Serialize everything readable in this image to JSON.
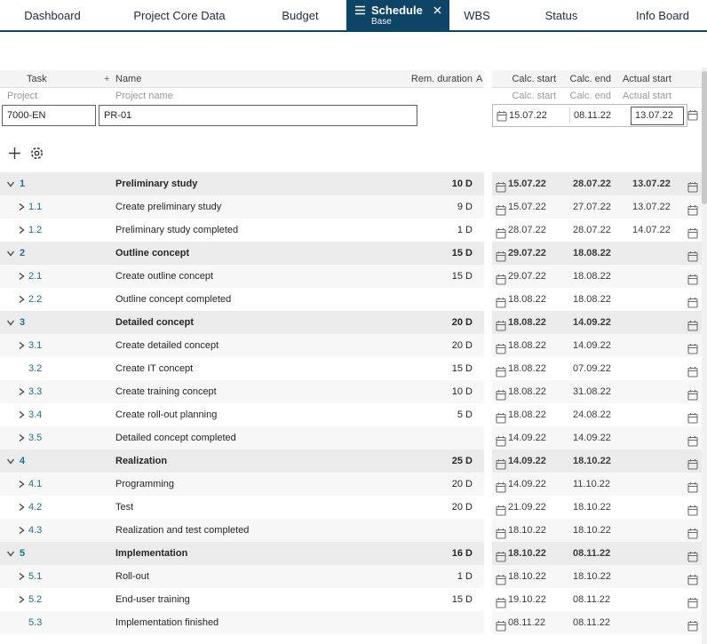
{
  "tabs": [
    {
      "label": "Dashboard"
    },
    {
      "label": "Project Core Data"
    },
    {
      "label": "Budget"
    },
    {
      "label": "Schedule",
      "sublabel": "Base",
      "active": true
    },
    {
      "label": "WBS"
    },
    {
      "label": "Status"
    },
    {
      "label": "Info Board"
    }
  ],
  "icons": {
    "active_tab_menu": "hamburger-icon",
    "active_tab_close": "close-icon",
    "toolbar_add": "plus-icon",
    "toolbar_settings": "gear-icon",
    "date_picker": "calendar-icon",
    "row_expand_open": "chevron-down-icon",
    "row_expand_closed": "chevron-right-icon"
  },
  "colors": {
    "active_tab_bg": "#0e4566",
    "active_tab_text": "#ffffff",
    "group_row_bg": "#ebebeb",
    "alt_row_bg": "#f7f7f7",
    "task_number_link": "#1e6f96",
    "header_bg": "#f4f4f4"
  },
  "table": {
    "headers": {
      "task": "Task",
      "add_column": "+",
      "name": "Name",
      "rem_duration": "Rem. duration",
      "a": "A",
      "calc_start": "Calc. start",
      "calc_end": "Calc. end",
      "actual_start": "Actual start"
    },
    "subheaders": {
      "project": "Project",
      "project_name": "Project name",
      "calc_start": "Calc. start",
      "calc_end": "Calc. end",
      "actual_start": "Actual start"
    },
    "project": {
      "id": "7000-EN",
      "name": "PR-01",
      "calc_start": "15.07.22",
      "calc_end": "08.11.22",
      "actual_start": "13.07.22"
    }
  },
  "rows": [
    {
      "num": "1",
      "name": "Preliminary study",
      "duration": "10 D",
      "calc_start": "15.07.22",
      "calc_end": "28.07.22",
      "actual_start": "13.07.22",
      "group": true,
      "chevron": "down"
    },
    {
      "num": "1.1",
      "name": "Create preliminary study",
      "duration": "9 D",
      "calc_start": "15.07.22",
      "calc_end": "27.07.22",
      "actual_start": "13.07.22",
      "group": false,
      "chevron": "right"
    },
    {
      "num": "1.2",
      "name": "Preliminary study completed",
      "duration": "1 D",
      "calc_start": "28.07.22",
      "calc_end": "28.07.22",
      "actual_start": "14.07.22",
      "group": false,
      "chevron": "right"
    },
    {
      "num": "2",
      "name": "Outline concept",
      "duration": "15 D",
      "calc_start": "29.07.22",
      "calc_end": "18.08.22",
      "actual_start": "",
      "group": true,
      "chevron": "down"
    },
    {
      "num": "2.1",
      "name": "Create outline concept",
      "duration": "15 D",
      "calc_start": "29.07.22",
      "calc_end": "18.08.22",
      "actual_start": "",
      "group": false,
      "chevron": "right"
    },
    {
      "num": "2.2",
      "name": "Outline concept completed",
      "duration": "",
      "calc_start": "18.08.22",
      "calc_end": "18.08.22",
      "actual_start": "",
      "group": false,
      "chevron": "right"
    },
    {
      "num": "3",
      "name": "Detailed concept",
      "duration": "20 D",
      "calc_start": "18.08.22",
      "calc_end": "14.09.22",
      "actual_start": "",
      "group": true,
      "chevron": "down"
    },
    {
      "num": "3.1",
      "name": "Create detailed concept",
      "duration": "20 D",
      "calc_start": "18.08.22",
      "calc_end": "14.09.22",
      "actual_start": "",
      "group": false,
      "chevron": "right"
    },
    {
      "num": "3.2",
      "name": "Create IT concept",
      "duration": "15 D",
      "calc_start": "18.08.22",
      "calc_end": "07.09.22",
      "actual_start": "",
      "group": false,
      "chevron": "none"
    },
    {
      "num": "3.3",
      "name": "Create training concept",
      "duration": "10 D",
      "calc_start": "18.08.22",
      "calc_end": "31.08.22",
      "actual_start": "",
      "group": false,
      "chevron": "right"
    },
    {
      "num": "3.4",
      "name": "Create roll-out planning",
      "duration": "5 D",
      "calc_start": "18.08.22",
      "calc_end": "24.08.22",
      "actual_start": "",
      "group": false,
      "chevron": "right"
    },
    {
      "num": "3.5",
      "name": "Detailed concept completed",
      "duration": "",
      "calc_start": "14.09.22",
      "calc_end": "14.09.22",
      "actual_start": "",
      "group": false,
      "chevron": "right"
    },
    {
      "num": "4",
      "name": "Realization",
      "duration": "25 D",
      "calc_start": "14.09.22",
      "calc_end": "18.10.22",
      "actual_start": "",
      "group": true,
      "chevron": "down"
    },
    {
      "num": "4.1",
      "name": "Programming",
      "duration": "20 D",
      "calc_start": "14.09.22",
      "calc_end": "11.10.22",
      "actual_start": "",
      "group": false,
      "chevron": "right"
    },
    {
      "num": "4.2",
      "name": "Test",
      "duration": "20 D",
      "calc_start": "21.09.22",
      "calc_end": "18.10.22",
      "actual_start": "",
      "group": false,
      "chevron": "right"
    },
    {
      "num": "4.3",
      "name": "Realization and test completed",
      "duration": "",
      "calc_start": "18.10.22",
      "calc_end": "18.10.22",
      "actual_start": "",
      "group": false,
      "chevron": "right"
    },
    {
      "num": "5",
      "name": "Implementation",
      "duration": "16 D",
      "calc_start": "18.10.22",
      "calc_end": "08.11.22",
      "actual_start": "",
      "group": true,
      "chevron": "down"
    },
    {
      "num": "5.1",
      "name": "Roll-out",
      "duration": "1 D",
      "calc_start": "18.10.22",
      "calc_end": "18.10.22",
      "actual_start": "",
      "group": false,
      "chevron": "right"
    },
    {
      "num": "5.2",
      "name": "End-user training",
      "duration": "15 D",
      "calc_start": "19.10.22",
      "calc_end": "08.11.22",
      "actual_start": "",
      "group": false,
      "chevron": "right"
    },
    {
      "num": "5.3",
      "name": "Implementation finished",
      "duration": "",
      "calc_start": "08.11.22",
      "calc_end": "08.11.22",
      "actual_start": "",
      "group": false,
      "chevron": "none"
    }
  ]
}
